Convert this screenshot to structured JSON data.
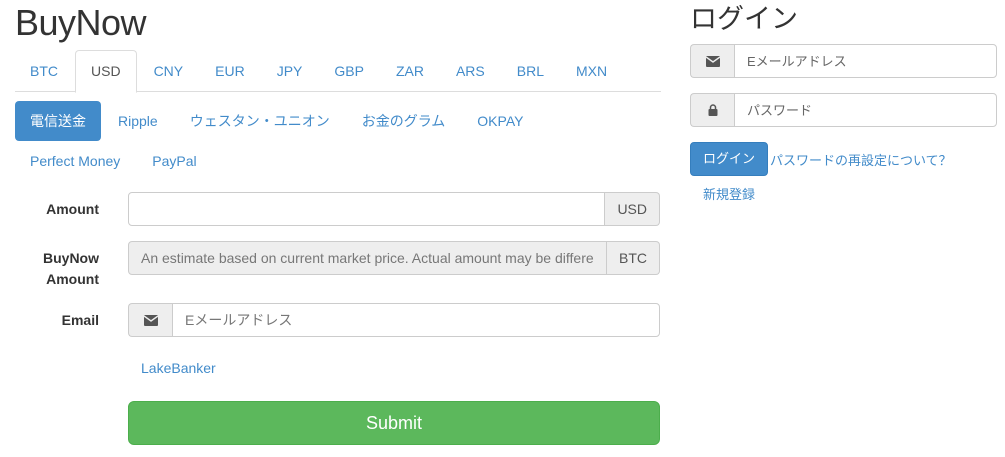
{
  "header": {
    "title": "BuyNow"
  },
  "currency_tabs": [
    {
      "label": "BTC",
      "active": false
    },
    {
      "label": "USD",
      "active": true
    },
    {
      "label": "CNY",
      "active": false
    },
    {
      "label": "EUR",
      "active": false
    },
    {
      "label": "JPY",
      "active": false
    },
    {
      "label": "GBP",
      "active": false
    },
    {
      "label": "ZAR",
      "active": false
    },
    {
      "label": "ARS",
      "active": false
    },
    {
      "label": "BRL",
      "active": false
    },
    {
      "label": "MXN",
      "active": false
    }
  ],
  "payment_methods": [
    {
      "label": "電信送金",
      "active": true
    },
    {
      "label": "Ripple",
      "active": false
    },
    {
      "label": "ウェスタン・ユニオン",
      "active": false
    },
    {
      "label": "お金のグラム",
      "active": false
    },
    {
      "label": "OKPAY",
      "active": false
    },
    {
      "label": "Perfect Money",
      "active": false
    },
    {
      "label": "PayPal",
      "active": false
    }
  ],
  "form": {
    "amount": {
      "label": "Amount",
      "value": "",
      "addon": "USD"
    },
    "buynow_amount": {
      "label_line1": "BuyNow",
      "label_line2": "Amount",
      "placeholder": "An estimate based on current market price. Actual amount may be different.",
      "addon": "BTC"
    },
    "email": {
      "label": "Email",
      "placeholder": "Eメールアドレス",
      "icon": "envelope-icon"
    },
    "seller_link": "LakeBanker",
    "submit_label": "Submit"
  },
  "login": {
    "title": "ログイン",
    "email_placeholder": "Eメールアドレス",
    "email_icon": "envelope-icon",
    "password_placeholder": "パスワード",
    "password_icon": "lock-icon",
    "login_button": "ログイン",
    "reset_link": "パスワードの再設定について？",
    "register_link": "新規登録"
  },
  "colors": {
    "link": "#428bca",
    "primary": "#428bca",
    "success": "#5cb85c",
    "addon_bg": "#eeeeee",
    "border": "#cccccc"
  }
}
